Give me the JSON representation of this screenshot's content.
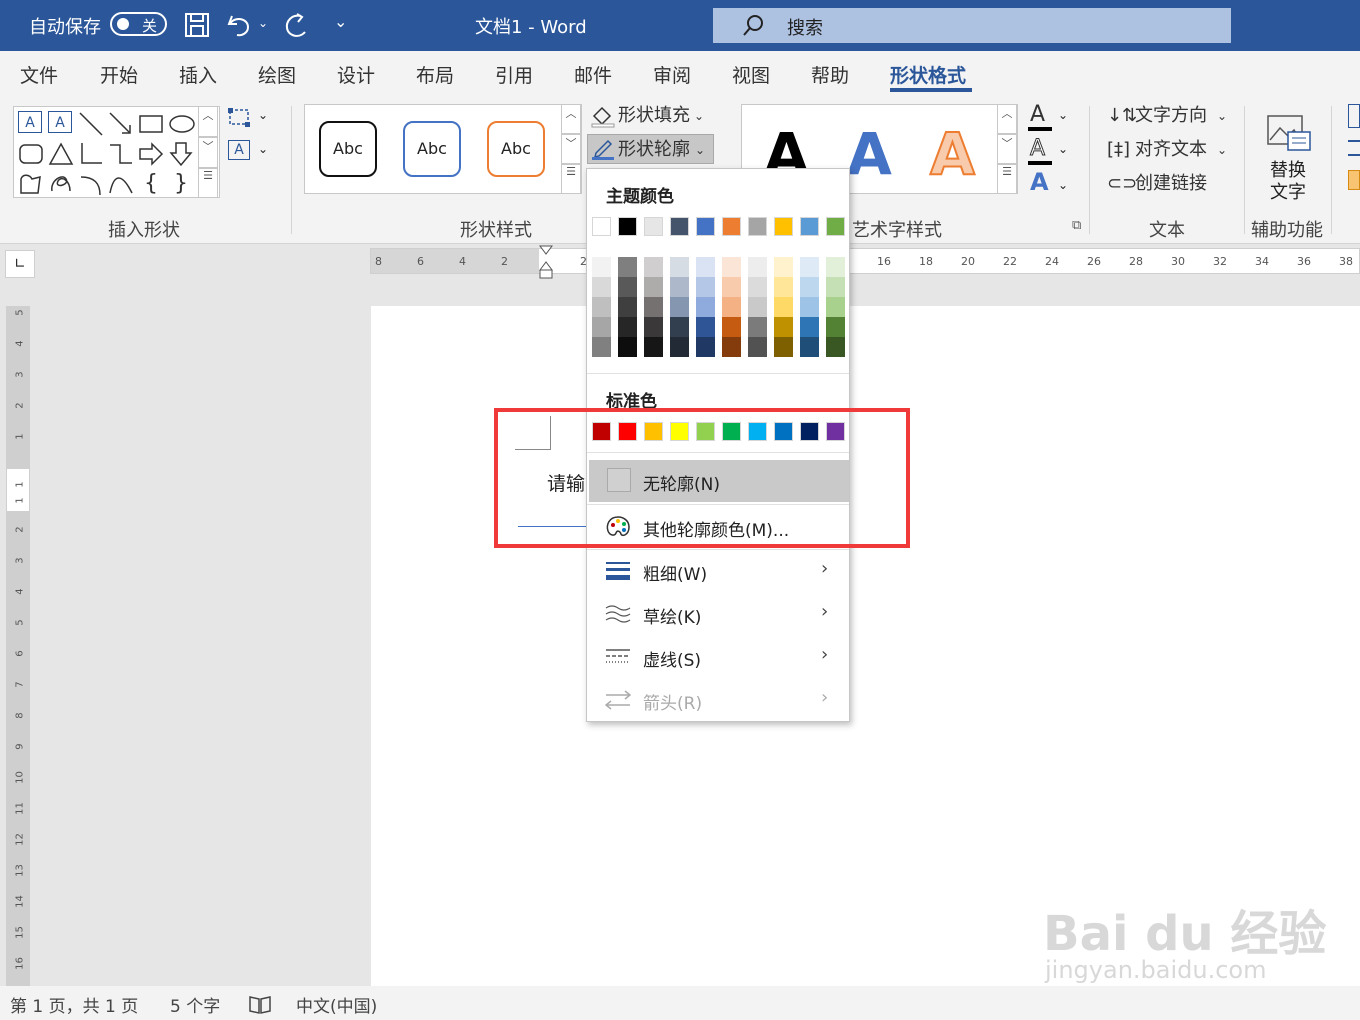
{
  "titlebar": {
    "autosave_label": "自动保存",
    "autosave_state": "关",
    "doc_title": "文档1  -  Word",
    "search_placeholder": "搜索"
  },
  "tabs": [
    "文件",
    "开始",
    "插入",
    "绘图",
    "设计",
    "布局",
    "引用",
    "邮件",
    "审阅",
    "视图",
    "帮助",
    "形状格式"
  ],
  "active_tab": "形状格式",
  "ribbon": {
    "groups": {
      "insert_shapes": "插入形状",
      "shape_styles": "形状样式",
      "wordart_styles": "艺术字样式",
      "text": "文本",
      "accessibility": "辅助功能"
    },
    "style_samples": [
      "Abc",
      "Abc",
      "Abc"
    ],
    "shape_fill": "形状填充",
    "shape_outline": "形状轮廓",
    "text_direction": "文字方向",
    "align_text": "对齐文本",
    "create_link": "创建链接",
    "alt_text_line1": "替换",
    "alt_text_line2": "文字",
    "wordart_letter": "A"
  },
  "ruler": {
    "h_ticks": [
      "8",
      "6",
      "4",
      "2",
      "2",
      "16",
      "18",
      "20",
      "22",
      "24",
      "26",
      "28",
      "30",
      "32",
      "34",
      "36",
      "38"
    ],
    "v_ticks": [
      "5",
      "4",
      "3",
      "2",
      "1",
      "1",
      "1",
      "2",
      "3",
      "4",
      "5",
      "6",
      "7",
      "8",
      "9",
      "10",
      "11",
      "12",
      "13",
      "14",
      "15",
      "16"
    ]
  },
  "document": {
    "partial_text": "请输"
  },
  "dropdown": {
    "theme_colors_label": "主题颜色",
    "theme_top": [
      "#ffffff",
      "#000000",
      "#e7e6e6",
      "#44546a",
      "#4472c4",
      "#ed7d31",
      "#a5a5a5",
      "#ffc000",
      "#5b9bd5",
      "#70ad47"
    ],
    "theme_shades": [
      [
        "#f2f2f2",
        "#d9d9d9",
        "#bfbfbf",
        "#a6a6a6",
        "#808080"
      ],
      [
        "#7f7f7f",
        "#595959",
        "#3f3f3f",
        "#262626",
        "#0d0d0d"
      ],
      [
        "#d0cece",
        "#aeabab",
        "#757171",
        "#3a3838",
        "#171616"
      ],
      [
        "#d6dce4",
        "#adb9ca",
        "#8496b0",
        "#323f4f",
        "#222a35"
      ],
      [
        "#dae3f3",
        "#b4c7e7",
        "#8faadc",
        "#2f5597",
        "#1f3864"
      ],
      [
        "#fbe5d6",
        "#f8cbad",
        "#f4b183",
        "#c55a11",
        "#843c0c"
      ],
      [
        "#ededed",
        "#dbdbdb",
        "#c9c9c9",
        "#7b7b7b",
        "#525252"
      ],
      [
        "#fff2cc",
        "#ffe699",
        "#ffd966",
        "#bf9000",
        "#7f6000"
      ],
      [
        "#deebf7",
        "#bdd7ee",
        "#9dc3e6",
        "#2e75b6",
        "#1f4e79"
      ],
      [
        "#e2f0d9",
        "#c5e0b4",
        "#a9d18e",
        "#548235",
        "#385723"
      ]
    ],
    "standard_colors_label": "标准色",
    "standard_colors": [
      "#c00000",
      "#ff0000",
      "#ffc000",
      "#ffff00",
      "#92d050",
      "#00b050",
      "#00b0f0",
      "#0070c0",
      "#002060",
      "#7030a0"
    ],
    "no_outline": "无轮廓(N)",
    "more_colors": "其他轮廓颜色(M)...",
    "weight": "粗细(W)",
    "sketched": "草绘(K)",
    "dashes": "虚线(S)",
    "arrows": "箭头(R)"
  },
  "status": {
    "page": "第 1 页，共 1 页",
    "words": "5 个字",
    "language": "中文(中国)"
  },
  "watermark": {
    "brand": "Bai du 经验",
    "url": "jingyan.baidu.com"
  }
}
